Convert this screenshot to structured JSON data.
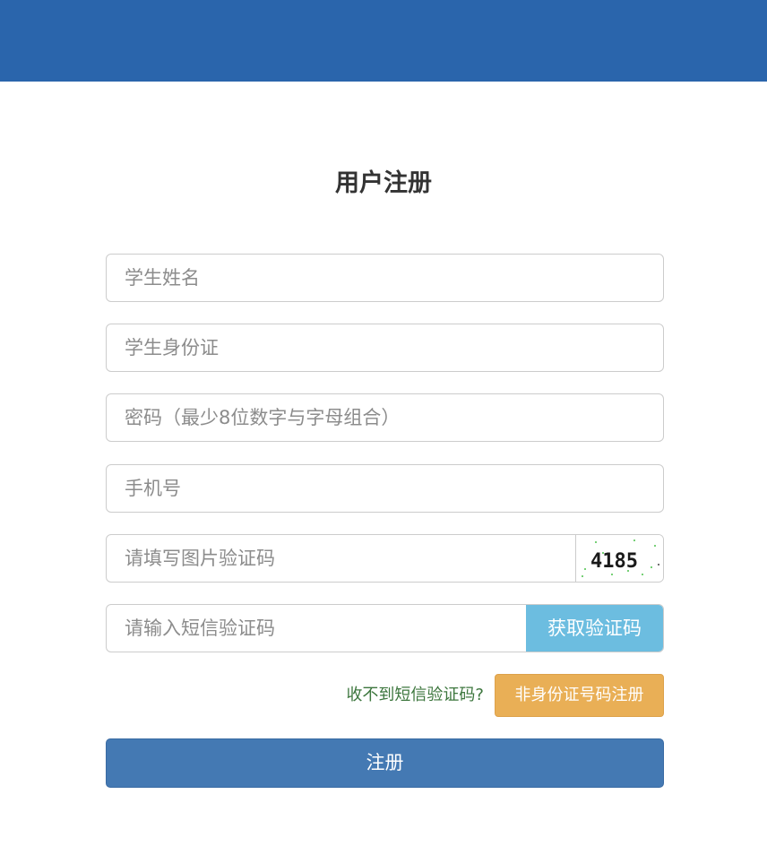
{
  "header": {
    "bar_color": "#2a65ac"
  },
  "form": {
    "title": "用户注册",
    "fields": {
      "student_name": {
        "placeholder": "学生姓名",
        "value": ""
      },
      "student_id_card": {
        "placeholder": "学生身份证",
        "value": ""
      },
      "password": {
        "placeholder": "密码（最少8位数字与字母组合）",
        "value": ""
      },
      "phone": {
        "placeholder": "手机号",
        "value": ""
      },
      "image_captcha": {
        "placeholder": "请填写图片验证码",
        "value": "",
        "captcha_text": "4185"
      },
      "sms_code": {
        "placeholder": "请输入短信验证码",
        "value": "",
        "button_label": "获取验证码"
      }
    },
    "help_link": "收不到短信验证码?",
    "alt_register_label": "非身份证号码注册",
    "submit_label": "注册"
  },
  "colors": {
    "sms_button": "#6cbde0",
    "alt_register_button": "#e9af56",
    "submit_button": "#4479b3",
    "help_link": "#3c763d"
  }
}
